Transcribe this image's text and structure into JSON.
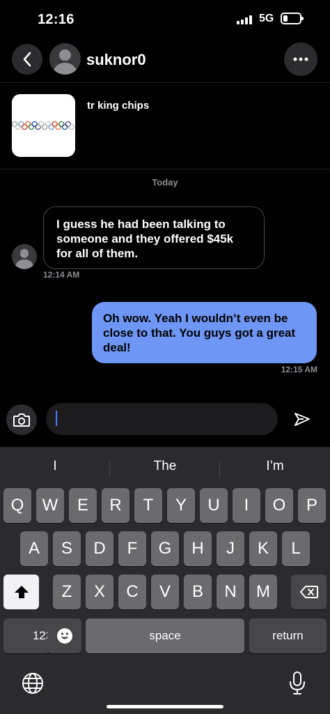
{
  "status_bar": {
    "time": "12:16",
    "network": "5G",
    "battery_percent": 28
  },
  "header": {
    "username": "suknor0",
    "back_icon": "chevron-left-icon",
    "more_icon": "ellipsis-icon"
  },
  "listing": {
    "title": "tr king chips"
  },
  "conversation": {
    "date_divider": "Today",
    "messages": [
      {
        "direction": "incoming",
        "text": "I guess he had been talking to someone and they offered $45k for all of them.",
        "time": "12:14 AM"
      },
      {
        "direction": "outgoing",
        "text": "Oh wow.  Yeah I wouldn’t even be close to that.    You guys got a great deal!",
        "time": "12:15 AM"
      }
    ]
  },
  "composer": {
    "value": "",
    "camera_icon": "camera-icon",
    "send_icon": "send-icon"
  },
  "keyboard": {
    "suggestions": [
      "I",
      "The",
      "I’m"
    ],
    "row1": [
      "Q",
      "W",
      "E",
      "R",
      "T",
      "Y",
      "U",
      "I",
      "O",
      "P"
    ],
    "row2": [
      "A",
      "S",
      "D",
      "F",
      "G",
      "H",
      "J",
      "K",
      "L"
    ],
    "row3": [
      "Z",
      "X",
      "C",
      "V",
      "B",
      "N",
      "M"
    ],
    "numbers_label": "123",
    "space_label": "space",
    "return_label": "return"
  },
  "colors": {
    "outgoing_bubble": "#6e96f4",
    "keyboard_bg": "#2b2b2d",
    "caret": "#4d7cff"
  }
}
